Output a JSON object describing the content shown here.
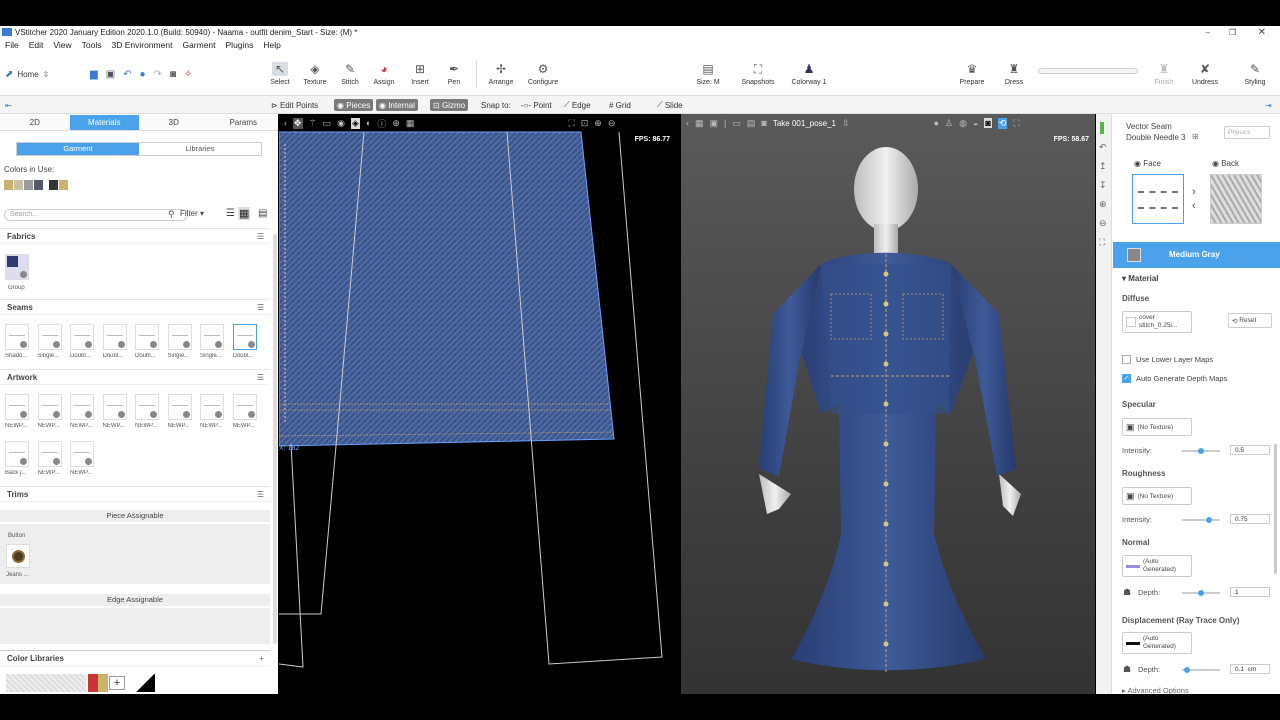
{
  "title": "VStitcher 2020 January Edition 2020.1.0 (Build: 50940) - Naama - outfit denim_Start - Size: (M) *",
  "menu": [
    "File",
    "Edit",
    "View",
    "Tools",
    "3D Environment",
    "Garment",
    "Plugins",
    "Help"
  ],
  "toolbar": {
    "home": "Home",
    "tools": [
      "Select",
      "Texture",
      "Stitch",
      "Assign",
      "Insert",
      "Pen",
      "Arrange",
      "Configure"
    ],
    "size": "Size: M",
    "snapshots": "Snapshots",
    "colorway": "Colorway 1",
    "right_tools": [
      "Prepare",
      "Dress",
      "Finish",
      "Undress",
      "Styling"
    ]
  },
  "subbar": {
    "edit_points": "Edit Points",
    "pieces": "Pieces",
    "internal": "Internal",
    "gizmo": "Gizmo",
    "snap_to": "Snap to:",
    "point": "Point",
    "edge": "Edge",
    "grid": "Grid",
    "slide": "Slide"
  },
  "left": {
    "tabs": [
      "2D",
      "Materials",
      "3D",
      "Params"
    ],
    "subtabs": [
      "Garment",
      "Libraries"
    ],
    "colors_in_use_label": "Colors in Use:",
    "colors": [
      "#c8b270",
      "#c9c0a0",
      "#9a9a9a",
      "#555a6a",
      "#333333",
      "#c9b46a"
    ],
    "search_placeholder": "Search...",
    "filter": "Filter",
    "fabrics": {
      "title": "Fabrics",
      "items": [
        "Group"
      ]
    },
    "seams": {
      "title": "Seams",
      "items": [
        "Shado...",
        "Single...",
        "Doubl...",
        "Doubl...",
        "Doubl...",
        "Single...",
        "Single...",
        "Doubl..."
      ]
    },
    "artwork": {
      "title": "Artwork",
      "items": [
        "NEWP...",
        "NEWP...",
        "NEWP...",
        "NEWP...",
        "NEWP...",
        "NEWP...",
        "NEWP...",
        "NEWP...",
        "Back j...",
        "NEWP...",
        "NEWP..."
      ]
    },
    "trims": {
      "title": "Trims",
      "piece_assignable": "Piece Assignable",
      "button_label": "Button",
      "jeans_label": "Jeans ...",
      "edge_assignable": "Edge Assignable"
    },
    "color_libraries": "Color Libraries"
  },
  "viewport2d": {
    "fps": "FPS: 86.77",
    "coord": "X: 182"
  },
  "viewport3d": {
    "fps": "FPS: 58.67",
    "take": "Take 001_pose_1"
  },
  "right": {
    "material_name": "Vector Seam",
    "sub_name": "Double Needle 3",
    "physics": "Physics",
    "face": "Face",
    "back": "Back",
    "color_name": "Medium Gray",
    "material_section": "Material",
    "diffuse": "Diffuse",
    "diffuse_tex": "cover stitch_0.25i...",
    "reset": "Reset",
    "use_lower": "Use Lower Layer Maps",
    "auto_depth": "Auto Generate Depth Maps",
    "specular": "Specular",
    "no_texture": "(No Texture)",
    "intensity": "Intensity:",
    "spec_val": "0.5",
    "spec_level": 0.5,
    "roughness": "Roughness",
    "rough_val": "0.75",
    "rough_level": 0.75,
    "normal": "Normal",
    "auto_generated": "(Auto Generated)",
    "depth": "Depth:",
    "normal_depth": "1",
    "normal_level": 0.5,
    "displacement": "Displacement (Ray Trace Only)",
    "disp_depth": "0.1",
    "disp_unit": "cm",
    "disp_level": 0.05,
    "advanced": "Advanced Options"
  }
}
